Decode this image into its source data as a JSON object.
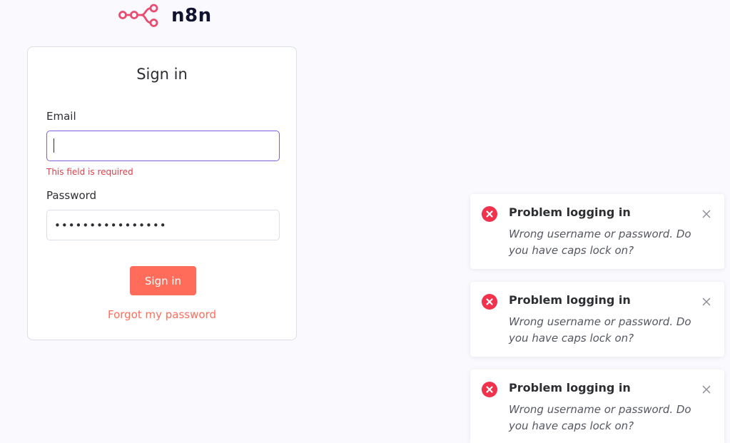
{
  "brand": {
    "name": "n8n",
    "accent_color": "#ff6d5a",
    "logo_color": "#ea4b71"
  },
  "signin": {
    "title": "Sign in",
    "email_label": "Email",
    "email_value": "",
    "email_error": "This field is required",
    "password_label": "Password",
    "password_value": "••••••••••••••••",
    "submit_label": "Sign in",
    "forgot_link": "Forgot my password"
  },
  "toasts": [
    {
      "icon": "error-icon",
      "title": "Problem logging in",
      "message": "Wrong username or password. Do you have caps lock on?"
    },
    {
      "icon": "error-icon",
      "title": "Problem logging in",
      "message": "Wrong username or password. Do you have caps lock on?"
    },
    {
      "icon": "error-icon",
      "title": "Problem logging in",
      "message": "Wrong username or password. Do you have caps lock on?"
    }
  ]
}
